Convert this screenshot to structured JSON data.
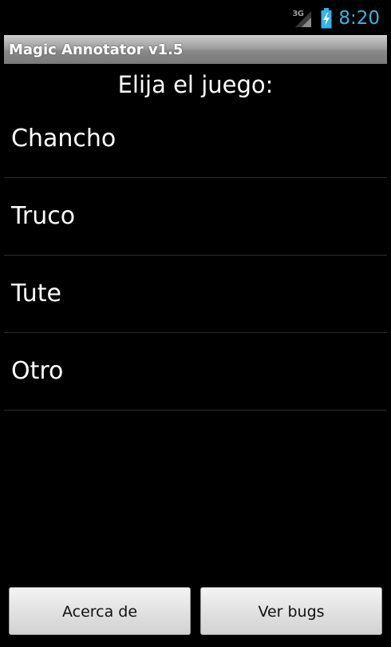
{
  "status_bar": {
    "network_type": "3G",
    "time": "8:20",
    "icons": [
      "signal-icon",
      "battery-charging-icon"
    ],
    "clock_color": "#33b5e5"
  },
  "title_bar": {
    "title": "Magic Annotator v1.5"
  },
  "main": {
    "heading": "Elija el juego:",
    "games": [
      {
        "label": "Chancho"
      },
      {
        "label": "Truco"
      },
      {
        "label": "Tute"
      },
      {
        "label": "Otro"
      }
    ]
  },
  "buttons": {
    "about_label": "Acerca de",
    "bugs_label": "Ver bugs"
  }
}
